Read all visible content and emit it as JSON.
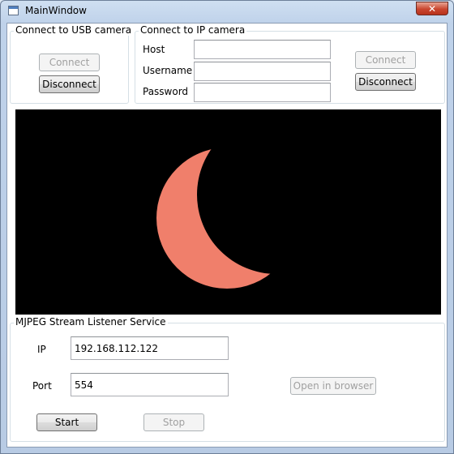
{
  "window": {
    "title": "MainWindow",
    "close_glyph": "✕"
  },
  "usb_camera": {
    "legend": "Connect to USB camera",
    "connect_label": "Connect",
    "disconnect_label": "Disconnect"
  },
  "ip_camera": {
    "legend": "Connect to IP camera",
    "host_label": "Host",
    "host_value": "",
    "username_label": "Username",
    "username_value": "",
    "password_label": "Password",
    "password_value": "",
    "connect_label": "Connect",
    "disconnect_label": "Disconnect"
  },
  "video": {
    "background_color": "#000000",
    "sun_color": "#f07f6b"
  },
  "mjpeg_service": {
    "legend": "MJPEG Stream Listener Service",
    "ip_label": "IP",
    "ip_value": "192.168.112.122",
    "port_label": "Port",
    "port_value": "554",
    "open_browser_label": "Open in browser",
    "start_label": "Start",
    "stop_label": "Stop"
  }
}
